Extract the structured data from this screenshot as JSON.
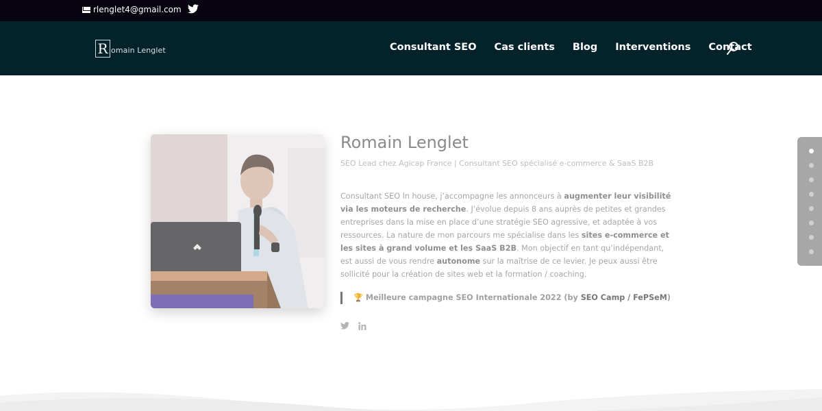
{
  "topbar": {
    "email": "rlenglet4@gmail.com",
    "social_icon": "twitter-icon"
  },
  "header": {
    "logo_letter": "R",
    "logo_text": "omain Lenglet",
    "nav": [
      "Consultant SEO",
      "Cas clients",
      "Blog",
      "Interventions",
      "Contact"
    ],
    "search_icon": "search-icon"
  },
  "profile": {
    "name": "Romain Lenglet",
    "subtitle": "SEO Lead chez Agicap France | Consultant SEO spécialisé e-commerce & SaaS B2B",
    "bio": {
      "p1": "Consultant SEO In house, j’accompagne les annonceurs à ",
      "b1": "augmenter leur visibilité via les moteurs de recherche",
      "p2": ". J’évolue depuis 8 ans auprès de petites et grandes entreprises dans la mise en place d’une stratégie SEO agressive, et adaptée à vos ressources. La nature de mon parcours me spécialise dans les ",
      "b2": "sites e-commerce et les sites à grand volume et les SaaS B2B",
      "p3": ". Mon objectif en tant qu’indépendant, est aussi de vous rendre ",
      "b3": "autonome",
      "p4": " sur la maîtrise de ce levier. Je peux aussi être sollicité pour la création de sites web et la formation / coaching."
    },
    "award": {
      "icon": "🏆",
      "text": " Meilleure campagne SEO Internationale 2022 (by ",
      "link": "SEO Camp / FePSeM",
      "end": ")"
    },
    "social": [
      "twitter-icon",
      "linkedin-icon"
    ]
  },
  "dot_nav": {
    "count": 8,
    "active_index": 0
  },
  "colors": {
    "topbar_bg": "#07040f",
    "header_bg": "#04222a",
    "dot_panel": "#a7a7a7"
  }
}
